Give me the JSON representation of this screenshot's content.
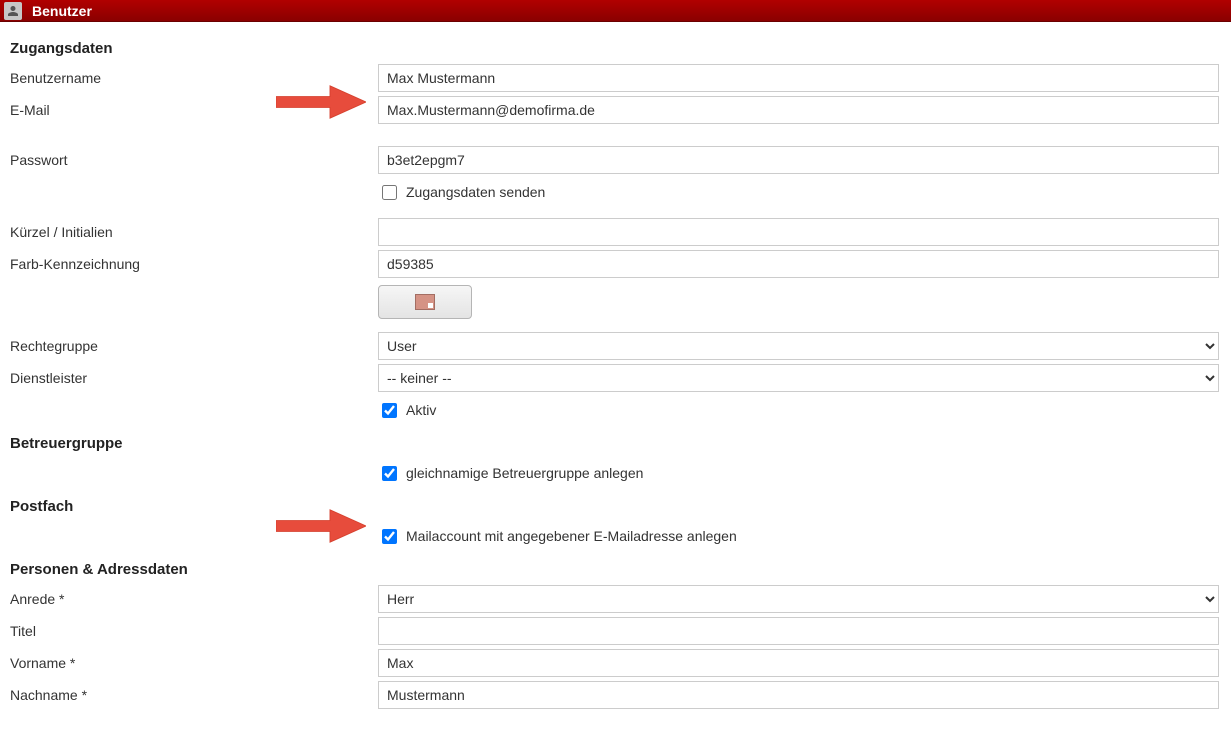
{
  "header": {
    "title": "Benutzer"
  },
  "sections": {
    "access": {
      "title": "Zugangsdaten",
      "username_label": "Benutzername",
      "username_value": "Max Mustermann",
      "email_label": "E-Mail",
      "email_value": "Max.Mustermann@demofirma.de",
      "password_label": "Passwort",
      "password_value": "b3et2epgm7",
      "send_access_label": "Zugangsdaten senden",
      "send_access_checked": false,
      "initials_label": "Kürzel / Initialien",
      "initials_value": "",
      "color_label": "Farb-Kennzeichnung",
      "color_value": "d59385",
      "rights_label": "Rechtegruppe",
      "rights_value": "User",
      "provider_label": "Dienstleister",
      "provider_value": "-- keiner --",
      "active_label": "Aktiv",
      "active_checked": true
    },
    "caregroup": {
      "title": "Betreuergruppe",
      "create_label": "gleichnamige Betreuergruppe anlegen",
      "create_checked": true
    },
    "mailbox": {
      "title": "Postfach",
      "create_label": "Mailaccount mit angegebener E-Mailadresse anlegen",
      "create_checked": true
    },
    "person": {
      "title": "Personen & Adressdaten",
      "salutation_label": "Anrede *",
      "salutation_value": "Herr",
      "title_label": "Titel",
      "title_value": "",
      "firstname_label": "Vorname *",
      "firstname_value": "Max",
      "lastname_label": "Nachname *",
      "lastname_value": "Mustermann"
    }
  }
}
